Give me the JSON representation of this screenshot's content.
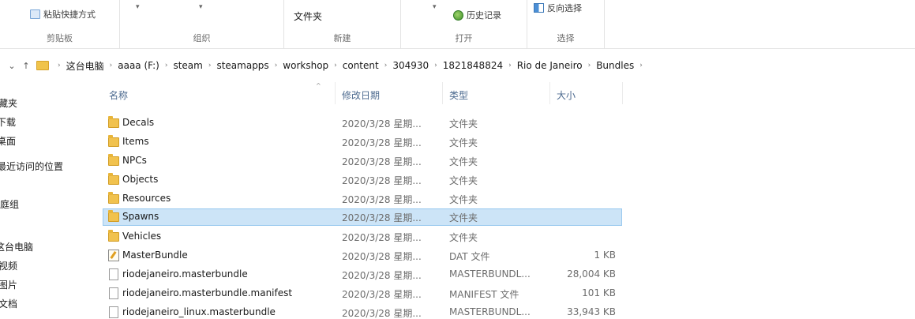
{
  "ribbon": {
    "clipboard": {
      "paste_shortcut_label": "粘贴快捷方式",
      "group_label": "剪贴板"
    },
    "organize": {
      "group_label": "组织"
    },
    "new": {
      "new_folder_label": "文件夹",
      "group_label": "新建"
    },
    "open": {
      "history_label": "历史记录",
      "group_label": "打开"
    },
    "select": {
      "invert_label": "反向选择",
      "group_label": "选择"
    }
  },
  "address_bar": {
    "back_icon": "chevron-left-icon",
    "up_icon": "arrow-up-icon",
    "path": [
      "这台电脑",
      "aaaa (F:)",
      "steam",
      "steamapps",
      "workshop",
      "content",
      "304930",
      "1821848824",
      "Rio de Janeiro",
      "Bundles"
    ]
  },
  "nav_pane": {
    "items": [
      "藏夹",
      "下载",
      "桌面",
      "最近访问的位置",
      "家庭组",
      "这台电脑",
      "视频",
      "图片",
      "文档"
    ]
  },
  "file_list": {
    "columns": {
      "name": "名称",
      "date": "修改日期",
      "type": "类型",
      "size": "大小"
    },
    "rows": [
      {
        "name": "Decals",
        "date": "2020/3/28 星期...",
        "type": "文件夹",
        "size": "",
        "icon": "folder-icon",
        "selected": false
      },
      {
        "name": "Items",
        "date": "2020/3/28 星期...",
        "type": "文件夹",
        "size": "",
        "icon": "folder-icon",
        "selected": false
      },
      {
        "name": "NPCs",
        "date": "2020/3/28 星期...",
        "type": "文件夹",
        "size": "",
        "icon": "folder-icon",
        "selected": false
      },
      {
        "name": "Objects",
        "date": "2020/3/28 星期...",
        "type": "文件夹",
        "size": "",
        "icon": "folder-icon",
        "selected": false
      },
      {
        "name": "Resources",
        "date": "2020/3/28 星期...",
        "type": "文件夹",
        "size": "",
        "icon": "folder-icon",
        "selected": false
      },
      {
        "name": "Spawns",
        "date": "2020/3/28 星期...",
        "type": "文件夹",
        "size": "",
        "icon": "folder-icon",
        "selected": true
      },
      {
        "name": "Vehicles",
        "date": "2020/3/28 星期...",
        "type": "文件夹",
        "size": "",
        "icon": "folder-icon",
        "selected": false
      },
      {
        "name": "MasterBundle",
        "date": "2020/3/28 星期...",
        "type": "DAT 文件",
        "size": "1 KB",
        "icon": "dat-file-icon",
        "selected": false
      },
      {
        "name": "riodejaneiro.masterbundle",
        "date": "2020/3/28 星期...",
        "type": "MASTERBUNDL...",
        "size": "28,004 KB",
        "icon": "file-icon",
        "selected": false
      },
      {
        "name": "riodejaneiro.masterbundle.manifest",
        "date": "2020/3/28 星期...",
        "type": "MANIFEST 文件",
        "size": "101 KB",
        "icon": "file-icon",
        "selected": false
      },
      {
        "name": "riodejaneiro_linux.masterbundle",
        "date": "2020/3/28 星期...",
        "type": "MASTERBUNDL...",
        "size": "33,943 KB",
        "icon": "file-icon",
        "selected": false
      }
    ]
  }
}
